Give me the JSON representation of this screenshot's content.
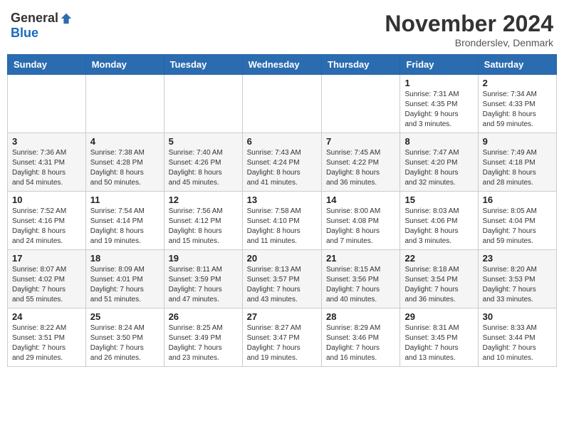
{
  "header": {
    "logo_general": "General",
    "logo_blue": "Blue",
    "title": "November 2024",
    "location": "Bronderslev, Denmark"
  },
  "days_of_week": [
    "Sunday",
    "Monday",
    "Tuesday",
    "Wednesday",
    "Thursday",
    "Friday",
    "Saturday"
  ],
  "weeks": [
    [
      {
        "day": "",
        "info": ""
      },
      {
        "day": "",
        "info": ""
      },
      {
        "day": "",
        "info": ""
      },
      {
        "day": "",
        "info": ""
      },
      {
        "day": "",
        "info": ""
      },
      {
        "day": "1",
        "info": "Sunrise: 7:31 AM\nSunset: 4:35 PM\nDaylight: 9 hours\nand 3 minutes."
      },
      {
        "day": "2",
        "info": "Sunrise: 7:34 AM\nSunset: 4:33 PM\nDaylight: 8 hours\nand 59 minutes."
      }
    ],
    [
      {
        "day": "3",
        "info": "Sunrise: 7:36 AM\nSunset: 4:31 PM\nDaylight: 8 hours\nand 54 minutes."
      },
      {
        "day": "4",
        "info": "Sunrise: 7:38 AM\nSunset: 4:28 PM\nDaylight: 8 hours\nand 50 minutes."
      },
      {
        "day": "5",
        "info": "Sunrise: 7:40 AM\nSunset: 4:26 PM\nDaylight: 8 hours\nand 45 minutes."
      },
      {
        "day": "6",
        "info": "Sunrise: 7:43 AM\nSunset: 4:24 PM\nDaylight: 8 hours\nand 41 minutes."
      },
      {
        "day": "7",
        "info": "Sunrise: 7:45 AM\nSunset: 4:22 PM\nDaylight: 8 hours\nand 36 minutes."
      },
      {
        "day": "8",
        "info": "Sunrise: 7:47 AM\nSunset: 4:20 PM\nDaylight: 8 hours\nand 32 minutes."
      },
      {
        "day": "9",
        "info": "Sunrise: 7:49 AM\nSunset: 4:18 PM\nDaylight: 8 hours\nand 28 minutes."
      }
    ],
    [
      {
        "day": "10",
        "info": "Sunrise: 7:52 AM\nSunset: 4:16 PM\nDaylight: 8 hours\nand 24 minutes."
      },
      {
        "day": "11",
        "info": "Sunrise: 7:54 AM\nSunset: 4:14 PM\nDaylight: 8 hours\nand 19 minutes."
      },
      {
        "day": "12",
        "info": "Sunrise: 7:56 AM\nSunset: 4:12 PM\nDaylight: 8 hours\nand 15 minutes."
      },
      {
        "day": "13",
        "info": "Sunrise: 7:58 AM\nSunset: 4:10 PM\nDaylight: 8 hours\nand 11 minutes."
      },
      {
        "day": "14",
        "info": "Sunrise: 8:00 AM\nSunset: 4:08 PM\nDaylight: 8 hours\nand 7 minutes."
      },
      {
        "day": "15",
        "info": "Sunrise: 8:03 AM\nSunset: 4:06 PM\nDaylight: 8 hours\nand 3 minutes."
      },
      {
        "day": "16",
        "info": "Sunrise: 8:05 AM\nSunset: 4:04 PM\nDaylight: 7 hours\nand 59 minutes."
      }
    ],
    [
      {
        "day": "17",
        "info": "Sunrise: 8:07 AM\nSunset: 4:02 PM\nDaylight: 7 hours\nand 55 minutes."
      },
      {
        "day": "18",
        "info": "Sunrise: 8:09 AM\nSunset: 4:01 PM\nDaylight: 7 hours\nand 51 minutes."
      },
      {
        "day": "19",
        "info": "Sunrise: 8:11 AM\nSunset: 3:59 PM\nDaylight: 7 hours\nand 47 minutes."
      },
      {
        "day": "20",
        "info": "Sunrise: 8:13 AM\nSunset: 3:57 PM\nDaylight: 7 hours\nand 43 minutes."
      },
      {
        "day": "21",
        "info": "Sunrise: 8:15 AM\nSunset: 3:56 PM\nDaylight: 7 hours\nand 40 minutes."
      },
      {
        "day": "22",
        "info": "Sunrise: 8:18 AM\nSunset: 3:54 PM\nDaylight: 7 hours\nand 36 minutes."
      },
      {
        "day": "23",
        "info": "Sunrise: 8:20 AM\nSunset: 3:53 PM\nDaylight: 7 hours\nand 33 minutes."
      }
    ],
    [
      {
        "day": "24",
        "info": "Sunrise: 8:22 AM\nSunset: 3:51 PM\nDaylight: 7 hours\nand 29 minutes."
      },
      {
        "day": "25",
        "info": "Sunrise: 8:24 AM\nSunset: 3:50 PM\nDaylight: 7 hours\nand 26 minutes."
      },
      {
        "day": "26",
        "info": "Sunrise: 8:25 AM\nSunset: 3:49 PM\nDaylight: 7 hours\nand 23 minutes."
      },
      {
        "day": "27",
        "info": "Sunrise: 8:27 AM\nSunset: 3:47 PM\nDaylight: 7 hours\nand 19 minutes."
      },
      {
        "day": "28",
        "info": "Sunrise: 8:29 AM\nSunset: 3:46 PM\nDaylight: 7 hours\nand 16 minutes."
      },
      {
        "day": "29",
        "info": "Sunrise: 8:31 AM\nSunset: 3:45 PM\nDaylight: 7 hours\nand 13 minutes."
      },
      {
        "day": "30",
        "info": "Sunrise: 8:33 AM\nSunset: 3:44 PM\nDaylight: 7 hours\nand 10 minutes."
      }
    ]
  ]
}
